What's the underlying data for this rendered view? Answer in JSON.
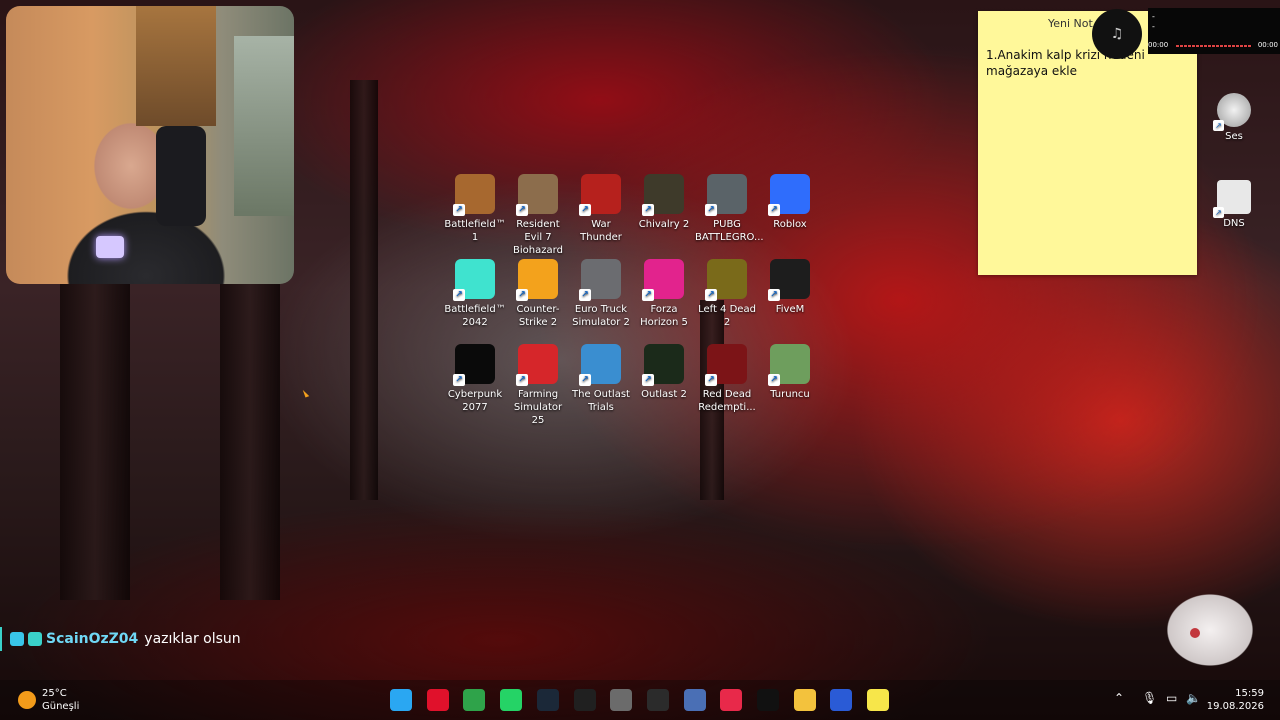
{
  "desktop_icons": [
    {
      "label": "Battlefield™ 1",
      "icon": "battlefield-1-icon",
      "color": "#a7682f"
    },
    {
      "label": "Resident Evil 7 Biohazard",
      "icon": "resident-evil-icon",
      "color": "#8c6d4c"
    },
    {
      "label": "War Thunder",
      "icon": "war-thunder-icon",
      "color": "#b6211d"
    },
    {
      "label": "Chivalry 2",
      "icon": "chivalry-icon",
      "color": "#3e3a2a"
    },
    {
      "label": "PUBG BATTLEGRO...",
      "icon": "pubg-icon",
      "color": "#5a6368"
    },
    {
      "label": "Roblox",
      "icon": "roblox-icon",
      "color": "#2f6dfc"
    },
    {
      "label": "Battlefield™ 2042",
      "icon": "battlefield-2042-icon",
      "color": "#3fe3cf"
    },
    {
      "label": "Counter-Strike 2",
      "icon": "counter-strike-icon",
      "color": "#f3a21c"
    },
    {
      "label": "Euro Truck Simulator 2",
      "icon": "euro-truck-icon",
      "color": "#6b6c70"
    },
    {
      "label": "Forza Horizon 5",
      "icon": "forza-icon",
      "color": "#e2238d"
    },
    {
      "label": "Left 4 Dead 2",
      "icon": "left4dead-icon",
      "color": "#7a6a1a"
    },
    {
      "label": "FiveM",
      "icon": "fivem-icon",
      "color": "#1d1d1d"
    },
    {
      "label": "Cyberpunk 2077",
      "icon": "cyberpunk-icon",
      "color": "#0a0a0a"
    },
    {
      "label": "Farming Simulator 25",
      "icon": "farming-sim-icon",
      "color": "#d6262a"
    },
    {
      "label": "The Outlast Trials",
      "icon": "outlast-trials-icon",
      "color": "#3a8ed0"
    },
    {
      "label": "Outlast 2",
      "icon": "outlast-2-icon",
      "color": "#1b2a1a"
    },
    {
      "label": "Red Dead Redempti...",
      "icon": "red-dead-icon",
      "color": "#7c1417"
    },
    {
      "label": "Turuncu",
      "icon": "turuncu-icon",
      "color": "#6e9e5d"
    }
  ],
  "sticky_note": {
    "title": "Yeni Not",
    "text": "1.Anakim kalp krizi nedeni mağazaya ekle"
  },
  "media_widget": {
    "dash": "-",
    "time_start": "00:00",
    "time_end": "00:00"
  },
  "right_icons": [
    {
      "label": "Ses",
      "icon": "speaker-icon"
    },
    {
      "label": "DNS",
      "icon": "dns-gear-icon"
    }
  ],
  "chat": {
    "username": "ScainOzZ04",
    "message": "yazıklar olsun"
  },
  "taskbar": {
    "weather_temp": "25°C",
    "weather_desc": "Güneşli",
    "apps": [
      {
        "name": "start-button-icon",
        "color": "#2aa7f2"
      },
      {
        "name": "opera-icon",
        "color": "#e0112b"
      },
      {
        "name": "chrome-icon",
        "color": "#2fa34a"
      },
      {
        "name": "whatsapp-icon",
        "color": "#25d366"
      },
      {
        "name": "steam-icon",
        "color": "#1b2838"
      },
      {
        "name": "epic-games-icon",
        "color": "#202020"
      },
      {
        "name": "github-desktop-icon",
        "color": "#6b6b6b"
      },
      {
        "name": "terminal-icon",
        "color": "#2b2b2b"
      },
      {
        "name": "notepad-icon",
        "color": "#4a6fb5"
      },
      {
        "name": "media-player-icon",
        "color": "#e8294a"
      },
      {
        "name": "capcut-icon",
        "color": "#111111"
      },
      {
        "name": "file-explorer-icon",
        "color": "#f3c23d"
      },
      {
        "name": "photos-icon",
        "color": "#2a5bd6"
      },
      {
        "name": "sticky-notes-icon",
        "color": "#f7e64a"
      }
    ],
    "time": "15:59",
    "date": "19.08.2026"
  }
}
